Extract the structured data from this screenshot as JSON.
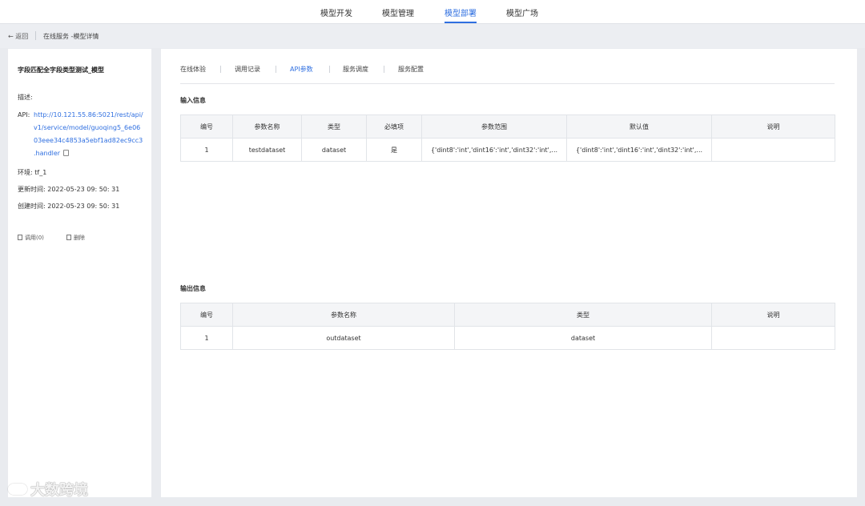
{
  "topnav": {
    "items": [
      {
        "label": "模型开发",
        "active": false
      },
      {
        "label": "模型管理",
        "active": false
      },
      {
        "label": "模型部署",
        "active": true
      },
      {
        "label": "模型广场",
        "active": false
      }
    ]
  },
  "breadcrumb": {
    "back_label": "← 返回",
    "path": "在线服务 -模型详情"
  },
  "sidebar": {
    "title": "字段匹配全字段类型测试_模型",
    "description_label": "描述:",
    "api_label": "API:",
    "api_lines": [
      "http://10.121.55.86:5021/rest/api/",
      "v1/service/model/guoqing5_6e06",
      "03eee34c4853a5ebf1ad82ec9cc3",
      ".handler"
    ],
    "environment": "环境: tf_1",
    "updated": "更新时间: 2022-05-23 09: 50: 31",
    "created": "创建时间: 2022-05-23 09: 50: 31",
    "actions": {
      "call": "调用(0)",
      "delete": "删除"
    }
  },
  "main": {
    "tabs": [
      {
        "label": "在线体验",
        "active": false
      },
      {
        "label": "调用记录",
        "active": false
      },
      {
        "label": "API参数",
        "active": true
      },
      {
        "label": "服务调度",
        "active": false
      },
      {
        "label": "服务配置",
        "active": false
      }
    ],
    "input_section": {
      "title": "输入信息",
      "columns": [
        "编号",
        "参数名称",
        "类型",
        "必填项",
        "参数范围",
        "默认值",
        "说明"
      ],
      "rows": [
        [
          "1",
          "testdataset",
          "dataset",
          "是",
          "{'dint8':'int','dint16':'int','dint32':'int',...",
          "{'dint8':'int','dint16':'int','dint32':'int',...",
          ""
        ]
      ]
    },
    "output_section": {
      "title": "输出信息",
      "columns": [
        "编号",
        "参数名称",
        "类型",
        "说明"
      ],
      "rows": [
        [
          "1",
          "outdataset",
          "dataset",
          ""
        ]
      ]
    }
  },
  "watermark": {
    "text": "大数跨境"
  },
  "colors": {
    "accent": "#2f6fe0",
    "background": "#e9ebef",
    "panel": "#ffffff"
  }
}
